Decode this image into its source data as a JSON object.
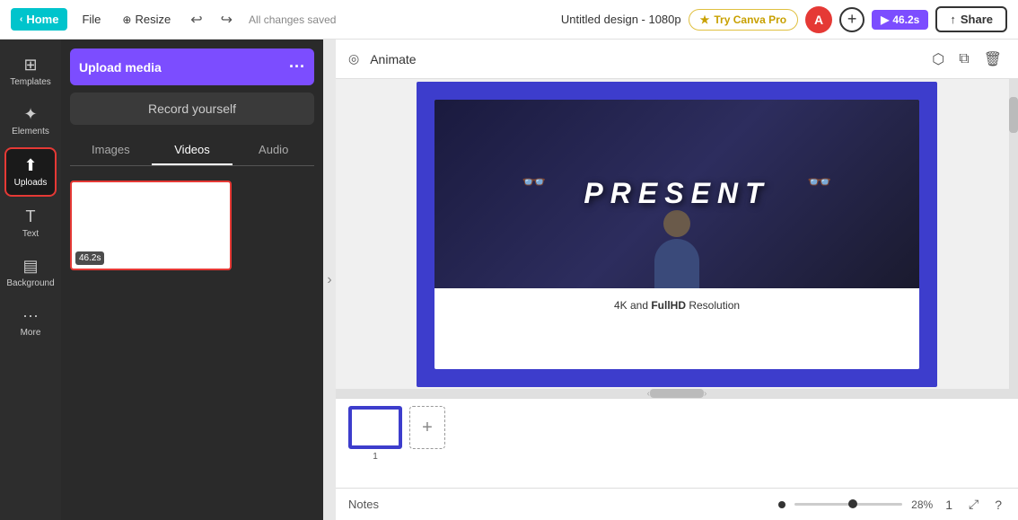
{
  "topNav": {
    "home": "Home",
    "file": "File",
    "resize": "Resize",
    "saved": "All changes saved",
    "designTitle": "Untitled design - 1080p",
    "tryCanvaPro": "Try Canva Pro",
    "avatarInitial": "A",
    "timer": "46.2s",
    "share": "Share"
  },
  "sidebar": {
    "items": [
      {
        "id": "templates",
        "label": "Templates",
        "icon": "⊞"
      },
      {
        "id": "elements",
        "label": "Elements",
        "icon": "✦"
      },
      {
        "id": "uploads",
        "label": "Uploads",
        "icon": "⬆"
      },
      {
        "id": "text",
        "label": "Text",
        "icon": "T"
      },
      {
        "id": "background",
        "label": "Background",
        "icon": "▤"
      },
      {
        "id": "more",
        "label": "More",
        "icon": "···"
      }
    ],
    "activeItem": "uploads"
  },
  "leftPanel": {
    "uploadMediaLabel": "Upload media",
    "uploadDotsLabel": "···",
    "recordYourselfLabel": "Record yourself",
    "tabs": [
      "Images",
      "Videos",
      "Audio"
    ],
    "activeTab": "Videos",
    "mediaBadge": "46.2s"
  },
  "canvasToolbar": {
    "animateLabel": "Animate"
  },
  "slide": {
    "presentText": "PRESENT",
    "captionHtml": "4K and FullHD Resolution"
  },
  "timeline": {
    "slideNumber": "1",
    "addSlideLabel": "+"
  },
  "notesBar": {
    "notesLabel": "Notes",
    "zoomLevel": "28%",
    "pageNumber": "1"
  }
}
